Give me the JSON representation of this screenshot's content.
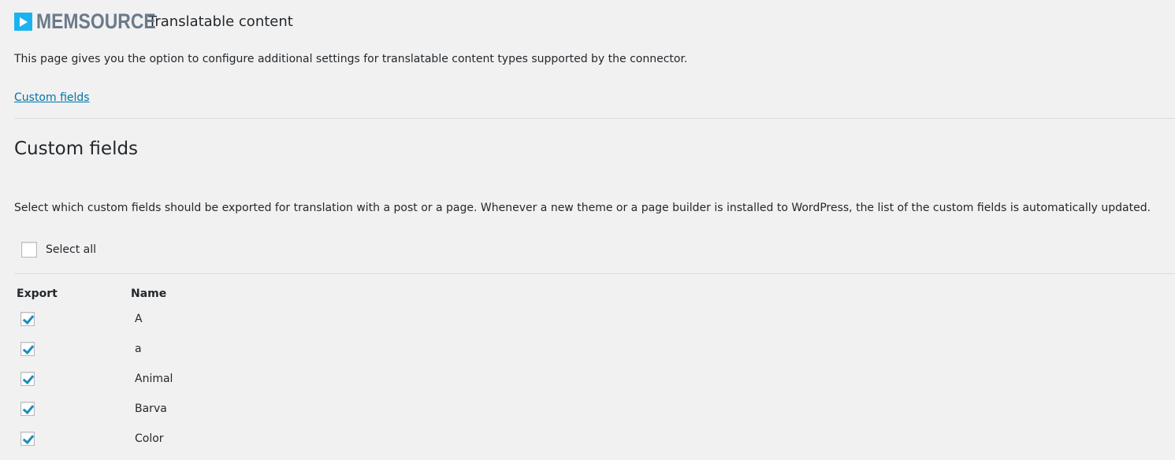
{
  "header": {
    "logo_text": "MEMSOURCE",
    "title": "Translatable content"
  },
  "description": "This page gives you the option to configure additional settings for translatable content types supported by the connector.",
  "nav_link": "Custom fields",
  "section": {
    "heading": "Custom fields",
    "description": "Select which custom fields should be exported for translation with a post or a page. Whenever a new theme or a page builder is installed to WordPress, the list of the custom fields is automatically updated.",
    "select_all": {
      "label": "Select all",
      "checked": false
    },
    "columns": {
      "export": "Export",
      "name": "Name"
    },
    "rows": [
      {
        "name": "A",
        "checked": true
      },
      {
        "name": "a",
        "checked": true
      },
      {
        "name": "Animal",
        "checked": true
      },
      {
        "name": "Barva",
        "checked": true
      },
      {
        "name": "Color",
        "checked": true
      }
    ]
  }
}
